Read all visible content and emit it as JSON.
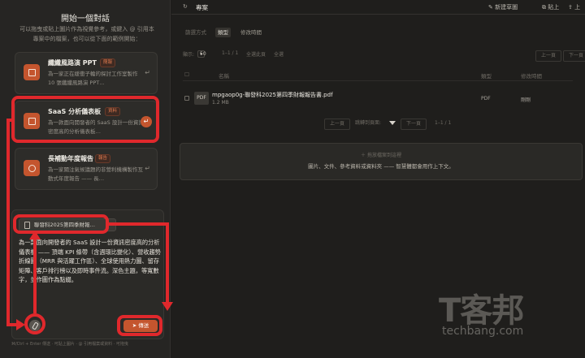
{
  "left": {
    "title": "開始一個對話",
    "description": "可以拖曳或貼上圖片作為視覺參考，或鍵入 @ 引用本專案中的檔案，也可以從下面的範例開始：",
    "cards": [
      {
        "title": "纖纖風路演 PPT",
        "tag": "簡報",
        "desc": "為一家正在緩衝子輪的探討工作室製作 10 張纖纖風路演 PPT…",
        "enter": "↵"
      },
      {
        "title": "SaaS 分析儀表板",
        "tag": "資料",
        "desc": "為一款面向開發者的 SaaS 設計一份資訊密度高的分析儀表板…",
        "enter": "↵"
      },
      {
        "title": "長補動年度報告",
        "tag": "報告",
        "desc": "為一家關注氣候議題的非營利機構製作互動式年度報告 —— 長…",
        "enter": "↵"
      }
    ],
    "composer": {
      "attachment": "聯發科2025第四季財報…",
      "prompt": "為一款面向開發者的 SaaS 設計一份資訊密度高的分析儀表板 —— 頂端 KPI 條帶（含週環比變化）、營收趨勢折線圖（MRR 與活躍工作區）、全球使用熱力圖、留存矩陣、客戶排行榜以及即時事件流。深色主題，等寬數字，並作圖作為點綴。",
      "send_label": "傳送",
      "send_icon": "paper-plane-icon",
      "attach_icon": "paperclip-icon"
    },
    "hint": "⌘/Ctrl + Enter 傳送 · 可貼上圖片 · @ 引用檔案或資料 · 可拖曳"
  },
  "right": {
    "topbar": {
      "refresh_icon": "↻",
      "title": "專案",
      "actions": [
        "新建草圖",
        "貼上",
        "上"
      ]
    },
    "filters": {
      "label": "篩選方式",
      "chip": "類型",
      "plain": "修改時間"
    },
    "pager": {
      "show_label": "顯示:",
      "page_size": "50",
      "range": "1–1 / 1",
      "select_all": "全選此頁",
      "all": "全選",
      "prev": "上一頁",
      "next": "下一頁"
    },
    "table": {
      "headers": [
        "名稱",
        "類型",
        "修改時間"
      ],
      "rows": [
        {
          "icon": "PDF",
          "name": "mpgaop0g-聯發科2025第四季財報報告書.pdf",
          "size": "1.2 MB",
          "type": "PDF",
          "modified": "剛剛"
        }
      ]
    },
    "pager2": {
      "prev": "上一頁",
      "jump": "跳轉到頁面:",
      "next": "下一頁",
      "range": "1–1 / 1"
    },
    "dropzone": {
      "line1": "＋ 拖放檔案到這裡",
      "line2": "圖片、文件、參考資料或資料夾 —— 智慧體都會用作上下文。"
    },
    "watermark": {
      "cn": "T客邦",
      "en": "techbang.com"
    }
  },
  "colors": {
    "accent": "#c4552e",
    "annotation": "#e0282c",
    "background": "#1d1c1a"
  }
}
